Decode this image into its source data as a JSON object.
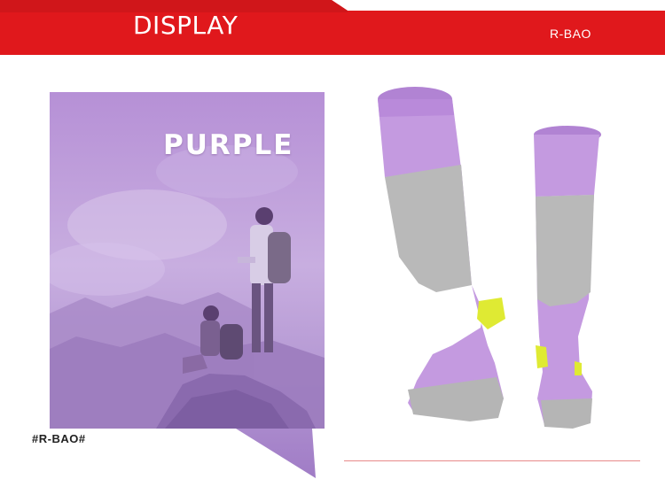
{
  "header": {
    "title": "DISPLAY",
    "brand": "R-BAO",
    "bar_color": "#e0181c",
    "accent_color": "#f03a3a"
  },
  "panel": {
    "color_label": "PURPLE",
    "tint_color": "#b28ad8"
  },
  "watermark": "#R-BAO#",
  "product": {
    "sock_color": "#c49ae0",
    "heel_color": "#dfea33",
    "panel_color": "#b9b9b9"
  }
}
